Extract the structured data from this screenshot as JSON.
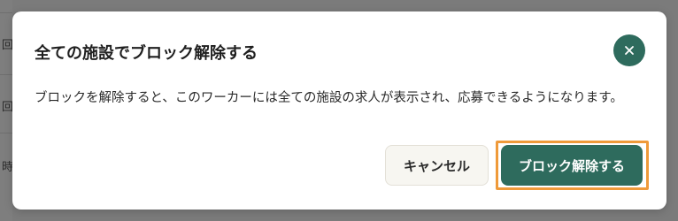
{
  "background": {
    "row_chars": [
      "回",
      "回",
      "時"
    ]
  },
  "dialog": {
    "title": "全ての施設でブロック解除する",
    "close_symbol": "×",
    "message": "ブロックを解除すると、このワーカーには全ての施設の求人が表示され、応募できるようになります。",
    "cancel_label": "キャンセル",
    "confirm_label": "ブロック解除する"
  },
  "colors": {
    "primary": "#2e6b5d",
    "focus_ring": "#ef9a3a",
    "cancel_bg": "#f7f6f1"
  }
}
